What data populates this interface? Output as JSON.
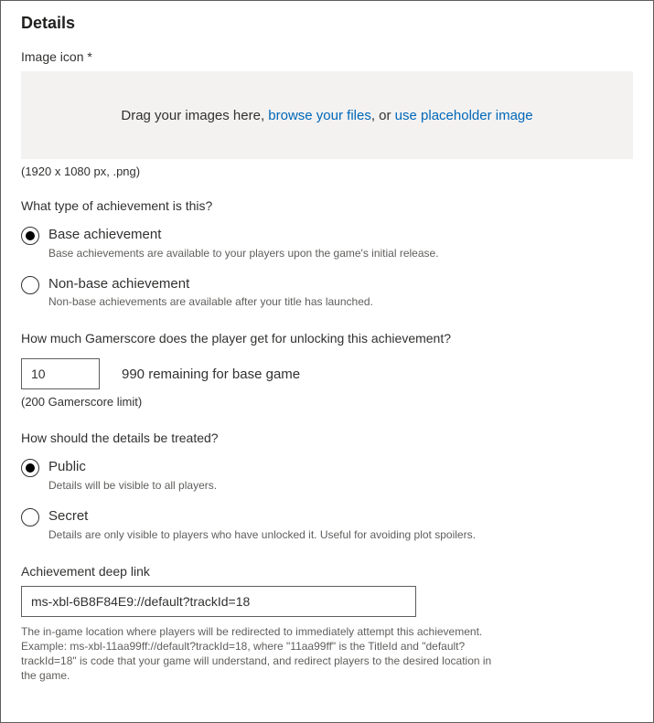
{
  "title": "Details",
  "image_icon": {
    "label": "Image icon *",
    "drop_prefix": "Drag your images here, ",
    "browse_link": "browse your files",
    "middle": ", or ",
    "placeholder_link": "use placeholder image",
    "hint": "(1920 x 1080 px, .png)"
  },
  "achievement_type": {
    "question": "What type of achievement is this?",
    "options": [
      {
        "label": "Base achievement",
        "desc": "Base achievements are available to your players upon the game's initial release.",
        "selected": true
      },
      {
        "label": "Non-base achievement",
        "desc": "Non-base achievements are available after your title has launched.",
        "selected": false
      }
    ]
  },
  "gamerscore": {
    "question": "How much Gamerscore does the player get for unlocking this achievement?",
    "value": "10",
    "remaining": "990 remaining for base game",
    "limit": "(200 Gamerscore limit)"
  },
  "visibility": {
    "question": "How should the details be treated?",
    "options": [
      {
        "label": "Public",
        "desc": "Details will be visible to all players.",
        "selected": true
      },
      {
        "label": "Secret",
        "desc": "Details are only visible to players who have unlocked it. Useful for avoiding plot spoilers.",
        "selected": false
      }
    ]
  },
  "deeplink": {
    "label": "Achievement deep link",
    "value": "ms-xbl-6B8F84E9://default?trackId=18",
    "help": "The in-game location where players will be redirected to immediately attempt this achievement. Example: ms-xbl-11aa99ff://default?trackId=18, where \"11aa99ff\" is the TitleId and \"default?trackId=18\" is code that your game will understand, and redirect players to the desired location in the game."
  }
}
